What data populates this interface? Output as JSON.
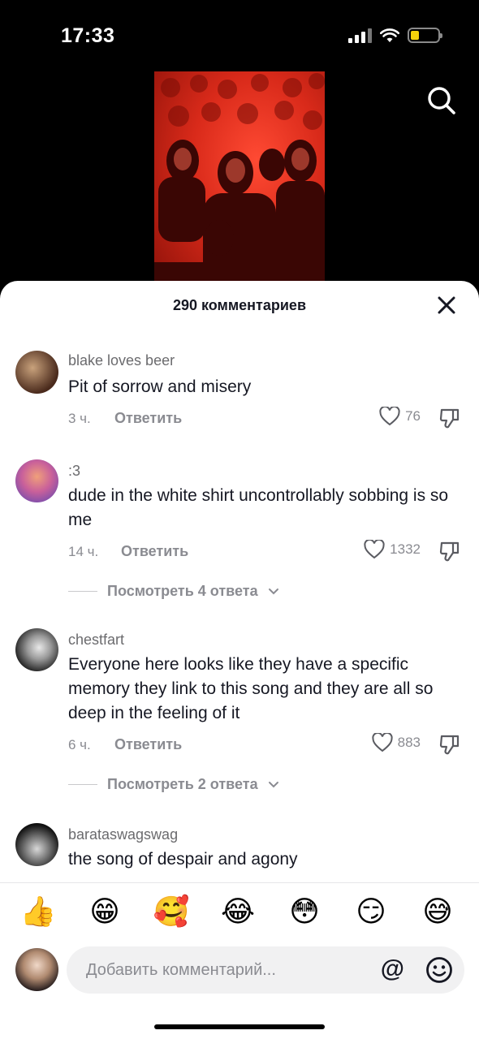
{
  "status_bar": {
    "time": "17:33",
    "battery_level": 0.3,
    "battery_color": "#f4d20b"
  },
  "video": {
    "tint_color": "#e0301f"
  },
  "sheet": {
    "title": "290 комментариев"
  },
  "comments": [
    {
      "user": "blake loves beer",
      "text": "Pit of sorrow and misery",
      "time": "3 ч.",
      "reply_label": "Ответить",
      "likes": "76"
    },
    {
      "user": ":3",
      "text": "dude in the white shirt uncontrollably sobbing is so me",
      "time": "14 ч.",
      "reply_label": "Ответить",
      "likes": "1332",
      "view_replies": "Посмотреть 4 ответа"
    },
    {
      "user": "chestfart",
      "text": "Everyone here looks like they have a specific memory they link to this song and they are all so deep in the feeling of it",
      "time": "6 ч.",
      "reply_label": "Ответить",
      "likes": "883",
      "view_replies": "Посмотреть 2 ответа"
    },
    {
      "user": "barataswagswag",
      "text": "the song of despair and agony"
    }
  ],
  "emoji_bar": [
    "👍",
    "😁",
    "🥰",
    "😂",
    "😳",
    "😏",
    "😅"
  ],
  "composer": {
    "placeholder": "Добавить комментарий...",
    "at_symbol": "@"
  }
}
